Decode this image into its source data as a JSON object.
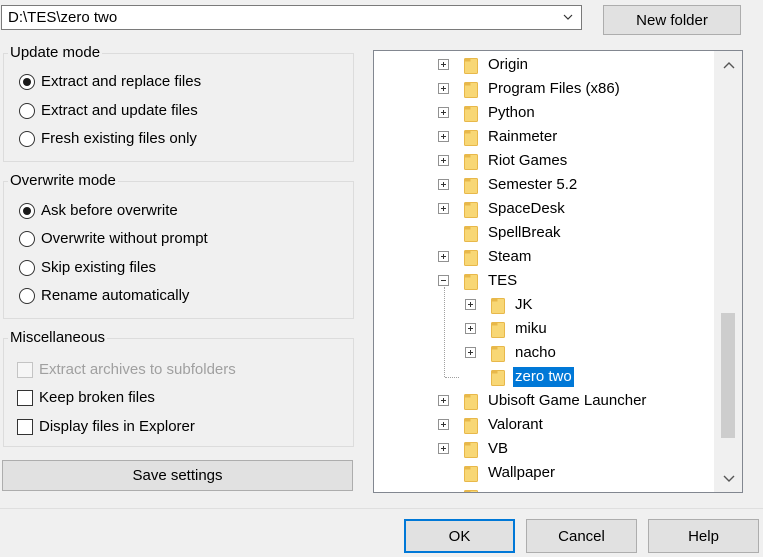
{
  "path": {
    "value": "D:\\TES\\zero two"
  },
  "new_folder_label": "New folder",
  "update_mode": {
    "title": "Update mode",
    "options": [
      {
        "label": "Extract and replace files",
        "checked": true
      },
      {
        "label": "Extract and update files",
        "checked": false
      },
      {
        "label": "Fresh existing files only",
        "checked": false
      }
    ]
  },
  "overwrite_mode": {
    "title": "Overwrite mode",
    "options": [
      {
        "label": "Ask before overwrite",
        "checked": true
      },
      {
        "label": "Overwrite without prompt",
        "checked": false
      },
      {
        "label": "Skip existing files",
        "checked": false
      },
      {
        "label": "Rename automatically",
        "checked": false
      }
    ]
  },
  "misc": {
    "title": "Miscellaneous",
    "options": [
      {
        "label": "Extract archives to subfolders",
        "checked": false,
        "disabled": true
      },
      {
        "label": "Keep broken files",
        "checked": false,
        "disabled": false
      },
      {
        "label": "Display files in Explorer",
        "checked": false,
        "disabled": false
      }
    ]
  },
  "save_settings_label": "Save settings",
  "tree": {
    "items": [
      {
        "label": "Origin",
        "expander": "plus",
        "level": 0
      },
      {
        "label": "Program Files (x86)",
        "expander": "plus",
        "level": 0
      },
      {
        "label": "Python",
        "expander": "plus",
        "level": 0
      },
      {
        "label": "Rainmeter",
        "expander": "plus",
        "level": 0
      },
      {
        "label": "Riot Games",
        "expander": "plus",
        "level": 0
      },
      {
        "label": "Semester 5.2",
        "expander": "plus",
        "level": 0
      },
      {
        "label": "SpaceDesk",
        "expander": "plus",
        "level": 0
      },
      {
        "label": "SpellBreak",
        "expander": "none",
        "level": 0
      },
      {
        "label": "Steam",
        "expander": "plus",
        "level": 0
      },
      {
        "label": "TES",
        "expander": "minus",
        "level": 0
      },
      {
        "label": "JK",
        "expander": "plus",
        "level": 1
      },
      {
        "label": "miku",
        "expander": "plus",
        "level": 1
      },
      {
        "label": "nacho",
        "expander": "plus",
        "level": 1
      },
      {
        "label": "zero two",
        "expander": "none",
        "level": 1,
        "selected": true
      },
      {
        "label": "Ubisoft Game Launcher",
        "expander": "plus",
        "level": 0
      },
      {
        "label": "Valorant",
        "expander": "plus",
        "level": 0
      },
      {
        "label": "VB",
        "expander": "plus",
        "level": 0
      },
      {
        "label": "Wallpaper",
        "expander": "none",
        "level": 0
      },
      {
        "label": "",
        "expander": "none",
        "level": 0
      }
    ]
  },
  "buttons": {
    "ok": "OK",
    "cancel": "Cancel",
    "help": "Help"
  },
  "colors": {
    "selection": "#0078d7",
    "folder": "#f8d775",
    "folder_dark": "#e8b84a",
    "default_button_border": "#0078d7"
  }
}
